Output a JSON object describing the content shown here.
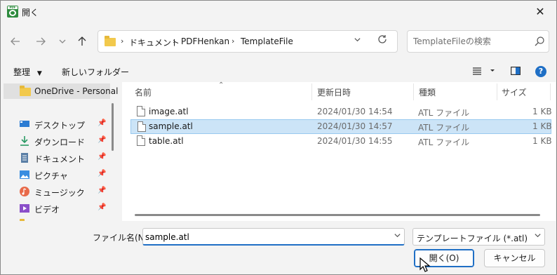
{
  "window": {
    "title": "開く"
  },
  "address": {
    "breadcrumbs": [
      "ドキュメント",
      "PDFHenkan",
      "TemplateFile"
    ]
  },
  "search": {
    "placeholder": "TemplateFileの検索"
  },
  "toolbar": {
    "organize": "整理",
    "new_folder": "新しいフォルダー"
  },
  "nav": {
    "items": [
      {
        "label": "OneDrive - Personal",
        "icon": "folder-icon",
        "pinned": false
      },
      {
        "label": "デスクトップ",
        "icon": "desktop-icon",
        "pinned": true
      },
      {
        "label": "ダウンロード",
        "icon": "download-icon",
        "pinned": true
      },
      {
        "label": "ドキュメント",
        "icon": "document-icon",
        "pinned": true
      },
      {
        "label": "ピクチャ",
        "icon": "picture-icon",
        "pinned": true
      },
      {
        "label": "ミュージック",
        "icon": "music-icon",
        "pinned": true
      },
      {
        "label": "ビデオ",
        "icon": "video-icon",
        "pinned": true
      }
    ]
  },
  "files": {
    "columns": [
      "名前",
      "更新日時",
      "種類",
      "サイズ"
    ],
    "rows": [
      {
        "name": "image.atl",
        "date": "2024/01/30 14:54",
        "type": "ATL ファイル",
        "size": "1 KB",
        "selected": false
      },
      {
        "name": "sample.atl",
        "date": "2024/01/30 14:57",
        "type": "ATL ファイル",
        "size": "1 KB",
        "selected": true
      },
      {
        "name": "table.atl",
        "date": "2024/01/30 14:55",
        "type": "ATL ファイル",
        "size": "1 KB",
        "selected": false
      }
    ]
  },
  "bottom": {
    "filename_label": "ファイル名(N):",
    "filename_value": "sample.atl",
    "filter": "テンプレートファイル (*.atl)",
    "open_button": "開く(O)",
    "cancel_button": "キャンセル"
  },
  "colors": {
    "accent": "#1f6fc5",
    "selection": "#cce4f7",
    "folder": "#f2c94c"
  }
}
